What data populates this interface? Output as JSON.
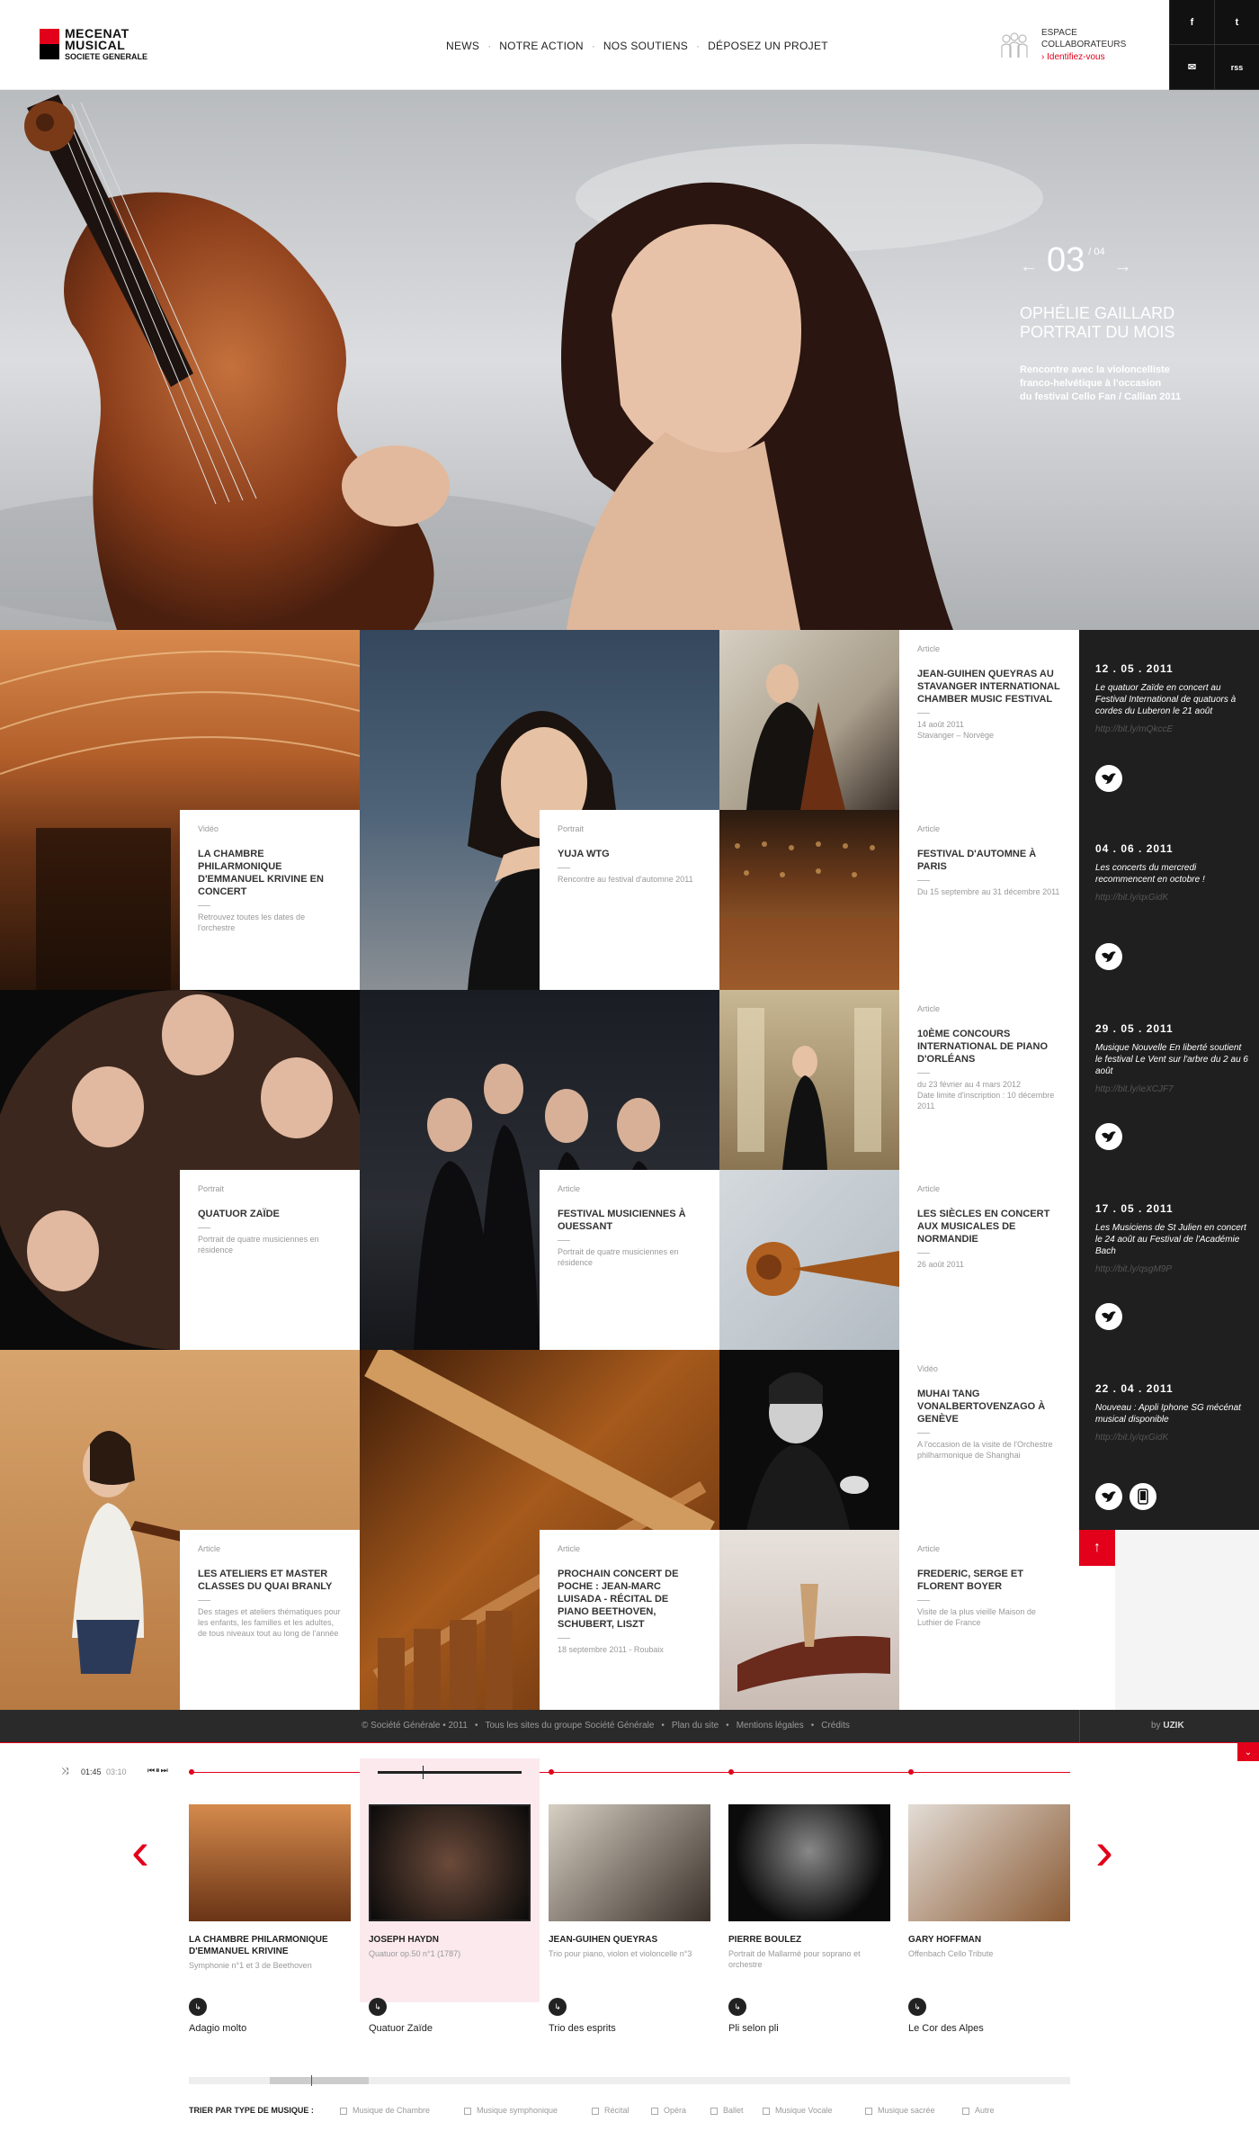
{
  "brand": {
    "name_line1": "MECENAT",
    "name_line2": "MUSICAL",
    "sub": "SOCIETE GENERALE"
  },
  "nav": [
    "NEWS",
    "NOTRE ACTION",
    "NOS SOUTIENS",
    "DÉPOSEZ UN PROJET"
  ],
  "espace": {
    "title": "ESPACE\nCOLLABORATEURS",
    "link": "› Identifiez-vous"
  },
  "social": {
    "facebook": "f",
    "twitter": "t",
    "email": "✉",
    "rss": "rss"
  },
  "hero": {
    "current": "03",
    "total": "/ 04",
    "title_line1": "OPHÉLIE GAILLARD",
    "title_line2": "PORTRAIT DU MOIS",
    "desc_line1": "Rencontre avec la violoncelliste",
    "desc_line2": "franco-helvétique à l'occasion",
    "desc_line3": "du festival Cello Fan / Callian 2011"
  },
  "cards": [
    {
      "type": "Vidéo",
      "title": "LA CHAMBRE PHILARMONIQUE D'EMMANUEL KRIVINE EN CONCERT",
      "desc": "Retrouvez toutes les dates de l'orchestre"
    },
    {
      "type": "Portrait",
      "title": "YUJA WTG",
      "desc": "Rencontre au festival d'automne 2011"
    },
    {
      "type": "Article",
      "title": "JEAN-GUIHEN QUEYRAS AU STAVANGER INTERNATIONAL CHAMBER MUSIC FESTIVAL",
      "desc": "14 août 2011\nStavanger – Norvège"
    },
    {
      "type": "Article",
      "title": "FESTIVAL D'AUTOMNE À PARIS",
      "desc": "Du 15 septembre au 31 décembre 2011"
    },
    {
      "type": "Portrait",
      "title": "QUATUOR ZAÏDE",
      "desc": "Portrait de quatre musiciennes en résidence"
    },
    {
      "type": "Article",
      "title": "FESTIVAL MUSICIENNES À OUESSANT",
      "desc": "Portrait de quatre musiciennes en résidence"
    },
    {
      "type": "Article",
      "title": "10ÈME CONCOURS INTERNATIONAL DE PIANO D'ORLÉANS",
      "desc": "du 23 février au 4 mars 2012\nDate limite d'inscription : 10 décembre 2011"
    },
    {
      "type": "Article",
      "title": "LES SIÈCLES EN CONCERT AUX MUSICALES DE NORMANDIE",
      "desc": "26 août 2011"
    },
    {
      "type": "Vidéo",
      "title": "MUHAI TANG VONALBERTOVENZAGO À GENÈVE",
      "desc": "A l'occasion de la visite de l'Orchestre philharmonique de Shanghai"
    },
    {
      "type": "Article",
      "title": "LES ATELIERS ET MASTER CLASSES DU QUAI BRANLY",
      "desc": "Des stages et ateliers thématiques pour les enfants, les familles et les adultes, de tous niveaux tout au long de l'année"
    },
    {
      "type": "Article",
      "title": "PROCHAIN CONCERT DE POCHE : JEAN-MARC LUISADA - RÉCITAL DE PIANO BEETHOVEN, SCHUBERT, LISZT",
      "desc": "18 septembre 2011 - Roubaix"
    },
    {
      "type": "Article",
      "title": "FREDERIC, SERGE ET FLORENT BOYER",
      "desc": "Visite de la plus vieille Maison de Luthier de France"
    }
  ],
  "news": [
    {
      "date": "12 . 05 . 2011",
      "text": "Le quatuor Zaïde en concert au Festival International de quatuors à cordes du Luberon le 21 août",
      "link": "http://bit.ly/mQkccE"
    },
    {
      "date": "04 . 06 . 2011",
      "text": "Les concerts du mercredi recommencent en octobre !",
      "link": "http://bit.ly/qxGidK"
    },
    {
      "date": "29 . 05 . 2011",
      "text": "Musique Nouvelle En liberté soutient le festival Le Vent sur l'arbre du 2 au 6 août",
      "link": "http://bit.ly/ieXCJF7"
    },
    {
      "date": "17 . 05 . 2011",
      "text": "Les Musiciens de St Julien en concert le 24 août au Festival de l'Académie Bach",
      "link": "http://bit.ly/qsgM9P"
    },
    {
      "date": "22 . 04 . 2011",
      "text": "Nouveau : Appli Iphone SG mécénat musical disponible",
      "link": "http://bit.ly/qxGidK"
    }
  ],
  "footer": {
    "links": [
      "© Société Générale • 2011",
      "Tous les sites du groupe Société Générale",
      "Plan du site",
      "Mentions légales",
      "Crédits"
    ],
    "by": "by",
    "uzik": "UZIK"
  },
  "player": {
    "elapsed": "01:45",
    "duration": "03:10"
  },
  "tracks": [
    {
      "title": "LA CHAMBRE PHILARMONIQUE D'EMMANUEL KRIVINE",
      "sub": "Symphonie n°1 et 3 de Beethoven",
      "song": "Adagio molto"
    },
    {
      "title": "JOSEPH HAYDN",
      "sub": "Quatuor op.50 n°1 (1787)",
      "song": "Quatuor Zaïde"
    },
    {
      "title": "JEAN-GUIHEN QUEYRAS",
      "sub": "Trio pour piano, violon et violoncelle n°3",
      "song": "Trio des esprits"
    },
    {
      "title": "PIERRE BOULEZ",
      "sub": "Portrait de Mallarmé pour soprano et orchestre",
      "song": "Pli selon pli"
    },
    {
      "title": "GARY HOFFMAN",
      "sub": "Offenbach Cello Tribute",
      "song": "Le Cor des Alpes"
    }
  ],
  "filters": {
    "label": "TRIER PAR TYPE DE MUSIQUE :",
    "items": [
      "Musique de Chambre",
      "Musique symphonique",
      "Récital",
      "Opéra",
      "Ballet",
      "Musique Vocale",
      "Musique sacrée",
      "Autre"
    ]
  },
  "colors": {
    "accent": "#e2001a",
    "dark": "#1f1f1f"
  }
}
